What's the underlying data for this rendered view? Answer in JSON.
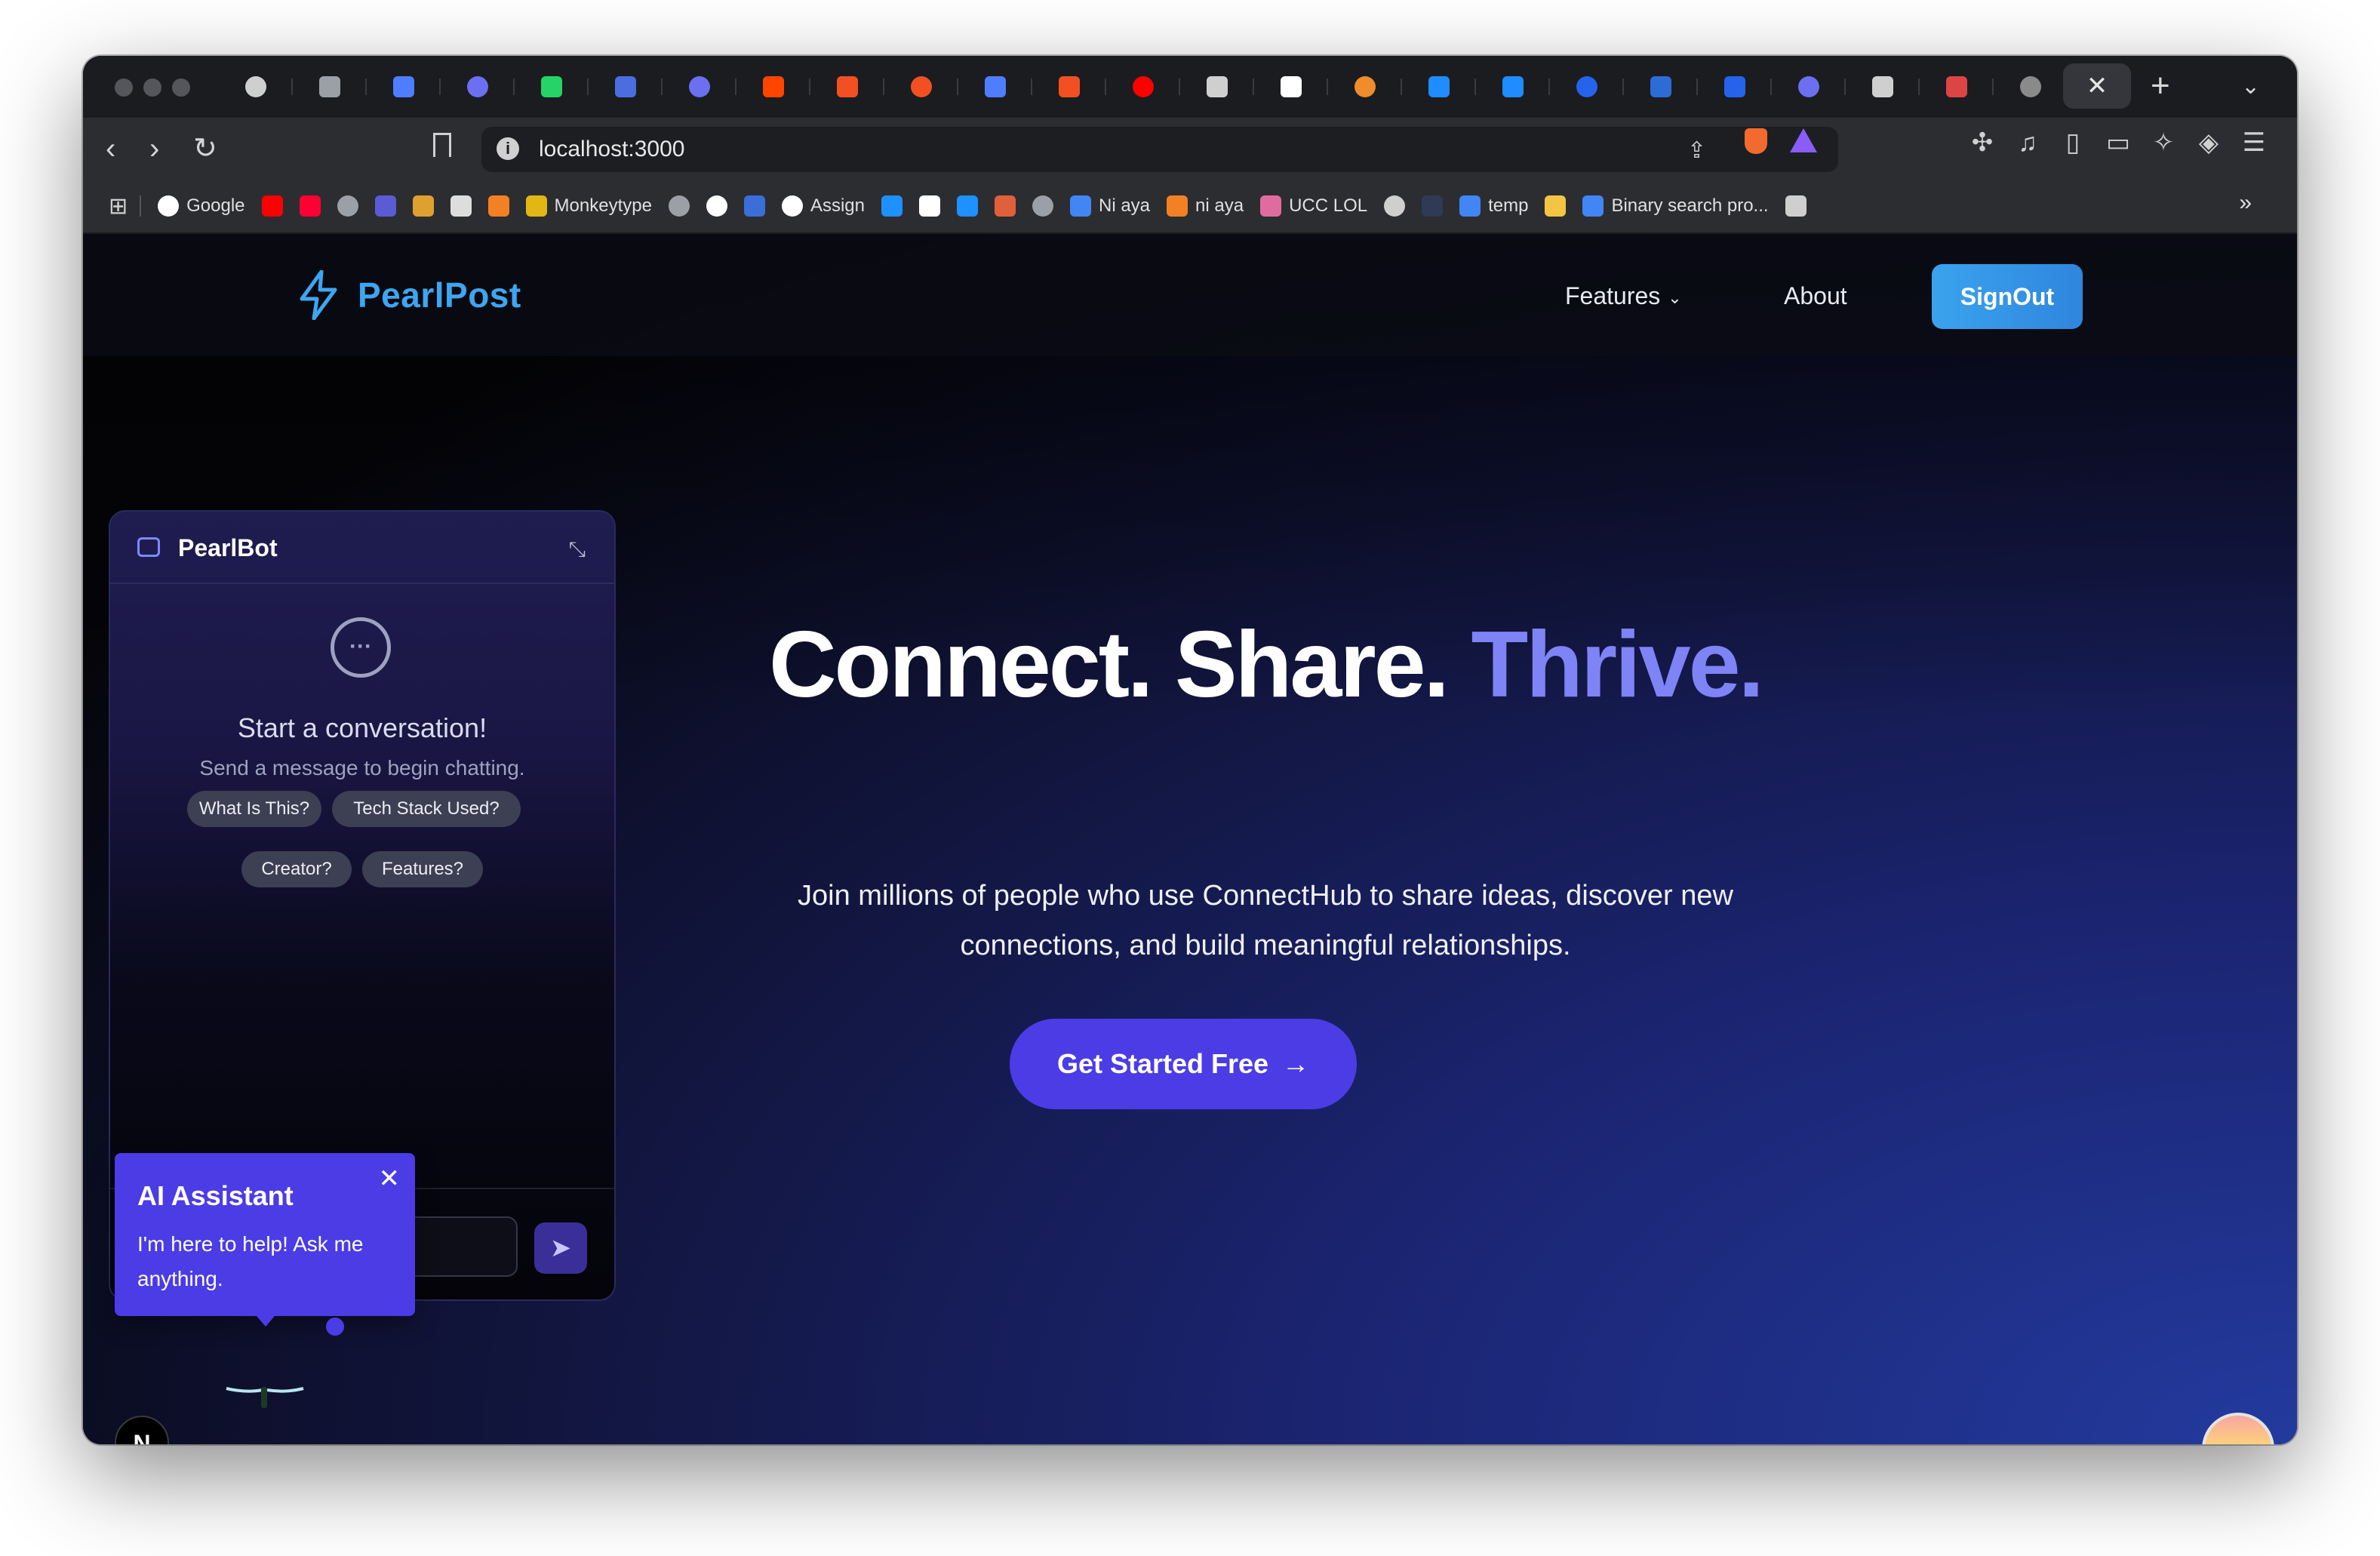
{
  "browser": {
    "url": "localhost:3000",
    "active_tab_close": "✕",
    "new_tab": "+",
    "tab_menu": "⌄",
    "nav": {
      "back": "‹",
      "forward": "›",
      "reload": "↻"
    },
    "tab_favicon_colors": [
      "#cfcfcf",
      "#9aa0a6",
      "#4f7dff",
      "#6b6ff0",
      "#25d366",
      "#4a6ee0",
      "#6b6ff0",
      "#ff4500",
      "#f25022",
      "#f25022",
      "#4f7dff",
      "#f25022",
      "#ff0000",
      "#cfcfcf",
      "#ffffff",
      "#f08c2c",
      "#1f8cff",
      "#1f8cff",
      "#2563eb",
      "#2d6bd6",
      "#2563eb",
      "#6b6ff0",
      "#cfcfcf",
      "#d44",
      "#8a8a8a"
    ]
  },
  "bookmarks": [
    {
      "label": "Google",
      "icon": "google-icon",
      "color": "#ffffff"
    },
    {
      "label": "",
      "icon": "youtube-icon",
      "color": "#ff0000"
    },
    {
      "label": "",
      "icon": "youtube-music-icon",
      "color": "#ff0033"
    },
    {
      "label": "",
      "icon": "globe-icon",
      "color": "#9aa0a6"
    },
    {
      "label": "",
      "icon": "code-icon",
      "color": "#5b5bd6"
    },
    {
      "label": "",
      "icon": "cc-icon",
      "color": "#e0a030"
    },
    {
      "label": "",
      "icon": "grid-icon",
      "color": "#dddddd"
    },
    {
      "label": "",
      "icon": "stack-icon",
      "color": "#f48024"
    },
    {
      "label": "Monkeytype",
      "icon": "monkeytype-icon",
      "color": "#e2b714"
    },
    {
      "label": "",
      "icon": "globe-icon",
      "color": "#9aa0a6"
    },
    {
      "label": "",
      "icon": "github-icon",
      "color": "#ffffff"
    },
    {
      "label": "",
      "icon": "profile-icon",
      "color": "#3b6ed8"
    },
    {
      "label": "Assign",
      "icon": "github-icon",
      "color": "#ffffff"
    },
    {
      "label": "",
      "icon": "k-icon",
      "color": "#1e90ff"
    },
    {
      "label": "",
      "icon": "m-icon",
      "color": "#ffffff"
    },
    {
      "label": "",
      "icon": "square-icon",
      "color": "#1e90ff"
    },
    {
      "label": "",
      "icon": "chart-icon",
      "color": "#e0603c"
    },
    {
      "label": "",
      "icon": "globe-icon",
      "color": "#9aa0a6"
    },
    {
      "label": "Ni aya",
      "icon": "bar-chart-icon",
      "color": "#4285f4"
    },
    {
      "label": "ni aya",
      "icon": "stack-icon",
      "color": "#f48024"
    },
    {
      "label": "UCC LOL",
      "icon": "ucc-icon",
      "color": "#e06c9f"
    },
    {
      "label": "",
      "icon": "openai-icon",
      "color": "#cfcfcf"
    },
    {
      "label": "",
      "icon": "dark-icon",
      "color": "#2f3a55"
    },
    {
      "label": "temp",
      "icon": "bar-chart-icon",
      "color": "#4285f4"
    },
    {
      "label": "",
      "icon": "image-icon",
      "color": "#f4c542"
    },
    {
      "label": "Binary search pro...",
      "icon": "bar-chart-icon",
      "color": "#4285f4"
    },
    {
      "label": "",
      "icon": "bookmark-folder-icon",
      "color": "#cfcfcf"
    }
  ],
  "bookmarks_more": "»",
  "site": {
    "brand": "PearlPost",
    "nav": {
      "features": "Features",
      "about": "About",
      "signout": "SignOut"
    },
    "hero": {
      "title_part1": "Connect. Share. ",
      "title_accent": "Thrive.",
      "subtitle_line1": "Join millions of people who use ConnectHub to share ideas, discover new",
      "subtitle_line2": "connections, and build meaningful relationships.",
      "cta": "Get Started Free"
    }
  },
  "chat": {
    "title": "PearlBot",
    "empty_heading": "Start a conversation!",
    "empty_text": "Send a message to begin chatting.",
    "chips": [
      "What Is This?",
      "Tech Stack Used?",
      "Creator?",
      "Features?"
    ],
    "input_placeholder": ""
  },
  "tooltip": {
    "title": "AI Assistant",
    "body": "I'm here to help! Ask me anything."
  },
  "next_badge": "N",
  "colors": {
    "accent": "#4b3ce6",
    "brand": "#3ea6f0",
    "hero_accent": "#7e83f6"
  }
}
